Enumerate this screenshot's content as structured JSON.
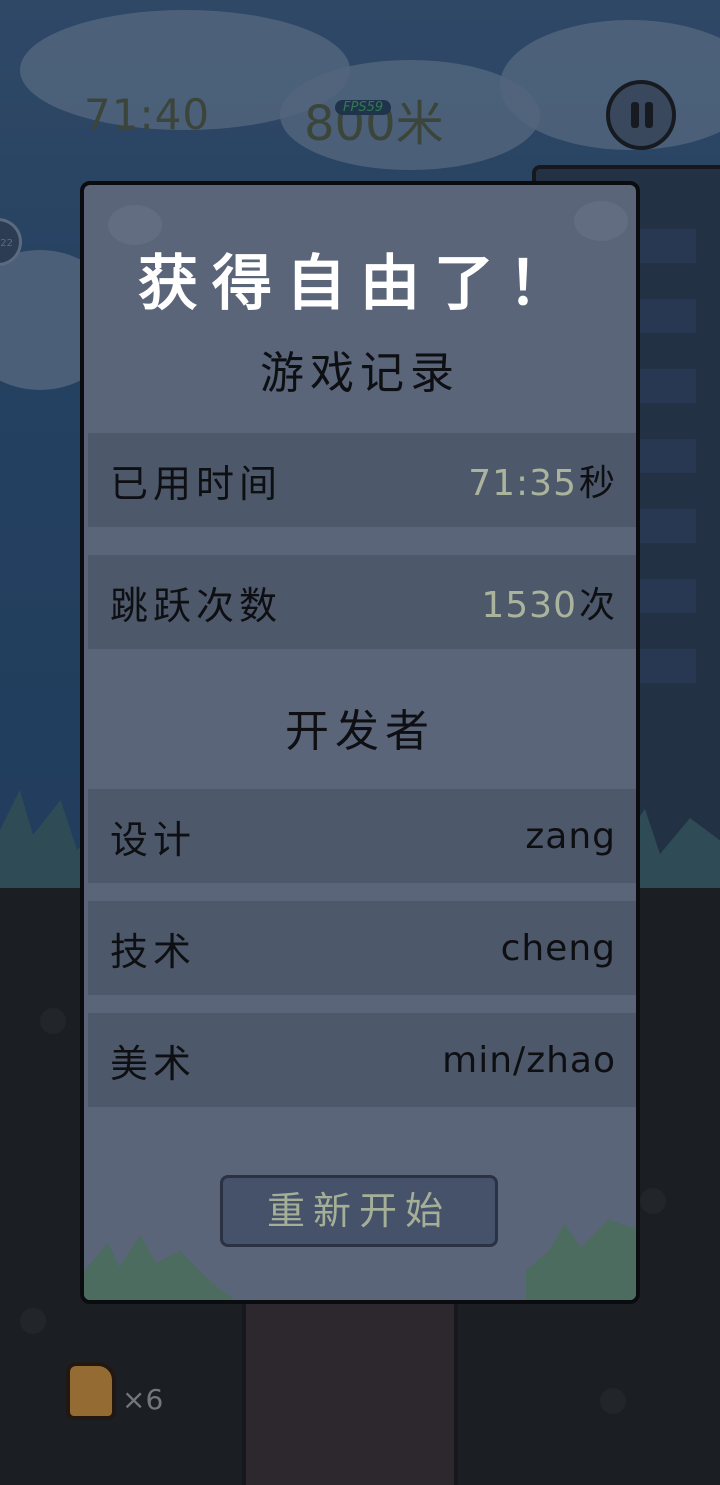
{
  "hud": {
    "time": "71:40",
    "distance": "800米",
    "fps": "FPS59",
    "left_badge": "22",
    "lives_count": "×6"
  },
  "dialog": {
    "title": "获得自由了！",
    "record_heading": "游戏记录",
    "stats": [
      {
        "label": "已用时间",
        "value": "71:35",
        "unit": "秒"
      },
      {
        "label": "跳跃次数",
        "value": "1530",
        "unit": "次"
      }
    ],
    "developers_heading": "开发者",
    "credits": [
      {
        "label": "设计",
        "value": "zang"
      },
      {
        "label": "技术",
        "value": "cheng"
      },
      {
        "label": "美术",
        "value": "min/zhao"
      }
    ],
    "restart_label": "重新开始"
  },
  "colors": {
    "panel_bg": "#5a6579",
    "row_bg": "#4e586b",
    "stat_number": "#aab49d",
    "button_bg": "#45526a",
    "title_text": "#ffffff"
  },
  "icons": [
    "pause-icon",
    "thumbs-up-icon"
  ]
}
